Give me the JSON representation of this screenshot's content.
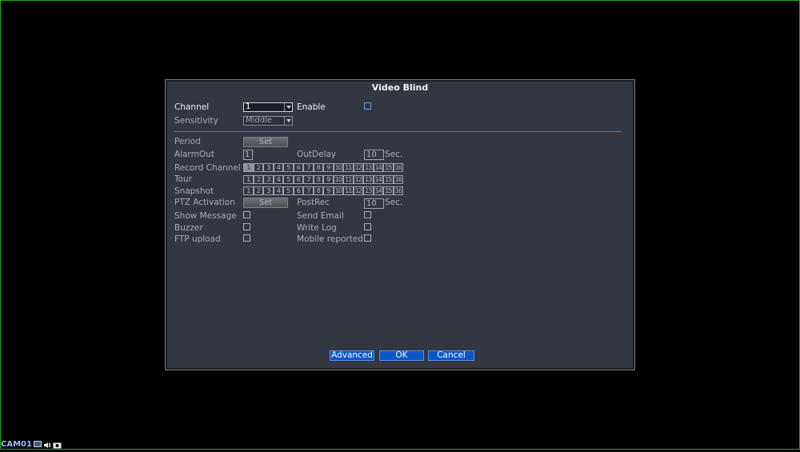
{
  "dialog": {
    "title": "Video Blind",
    "channel": {
      "label": "Channel",
      "value": "1"
    },
    "enable": {
      "label": "Enable",
      "checked": false
    },
    "sensitivity": {
      "label": "Sensitivity",
      "value": "Middle"
    },
    "period": {
      "label": "Period",
      "button": "Set"
    },
    "alarm_out": {
      "label": "AlarmOut",
      "value": "1"
    },
    "out_delay": {
      "label": "OutDelay",
      "value": "10",
      "unit": "Sec."
    },
    "record_channel": {
      "label": "Record Channel",
      "selected": [
        1
      ]
    },
    "tour": {
      "label": "Tour",
      "selected": []
    },
    "snapshot": {
      "label": "Snapshot",
      "selected": []
    },
    "channels": [
      "1",
      "2",
      "3",
      "4",
      "5",
      "6",
      "7",
      "8",
      "9",
      "10",
      "11",
      "12",
      "13",
      "14",
      "15",
      "16"
    ],
    "ptz_activation": {
      "label": "PTZ Activation",
      "button": "Set"
    },
    "post_rec": {
      "label": "PostRec",
      "value": "10",
      "unit": "Sec."
    },
    "show_message": {
      "label": "Show Message",
      "checked": false
    },
    "send_email": {
      "label": "Send Email",
      "checked": false
    },
    "buzzer": {
      "label": "Buzzer",
      "checked": false
    },
    "write_log": {
      "label": "Write Log",
      "checked": false
    },
    "ftp_upload": {
      "label": "FTP upload",
      "checked": false
    },
    "mobile_reported": {
      "label": "Mobile reported",
      "checked": false
    },
    "buttons": {
      "advanced": "Advanced",
      "ok": "OK",
      "cancel": "Cancel"
    }
  },
  "status": {
    "camera": "CAM01",
    "icons": [
      "record-icon",
      "audio-icon",
      "camera-icon"
    ]
  },
  "colors": {
    "accent": "#0a56c7",
    "dialog_bg": "#333741",
    "divider": "#3f7fc9",
    "frame": "#1fa51f"
  }
}
